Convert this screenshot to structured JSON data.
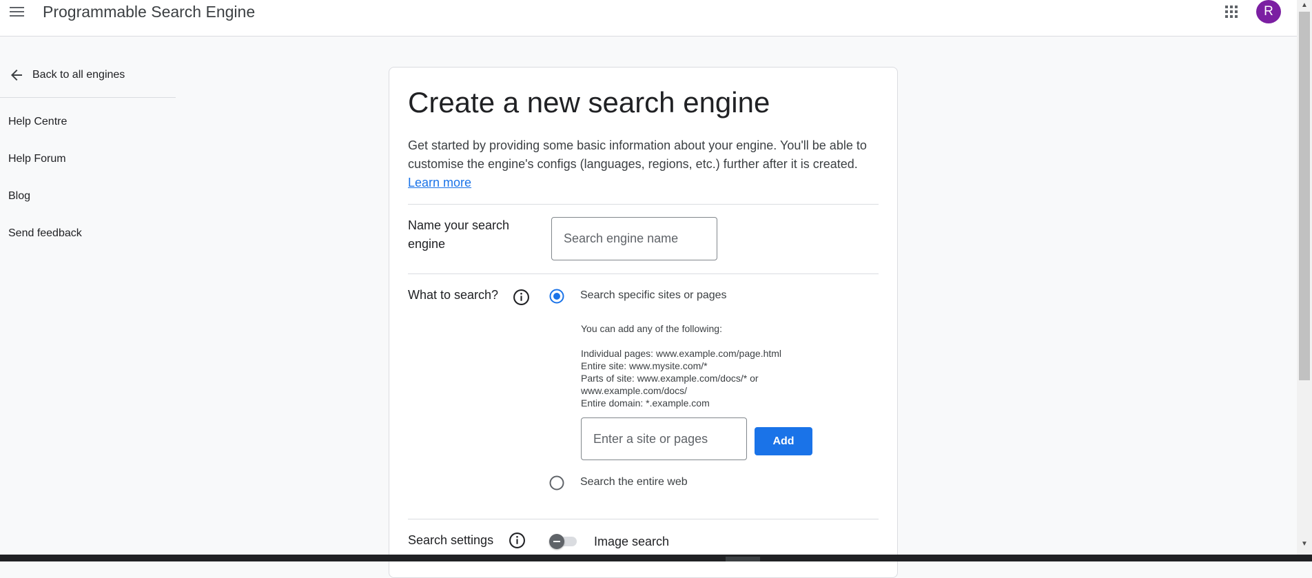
{
  "header": {
    "app_title": "Programmable Search Engine",
    "avatar_initial": "R",
    "avatar_color": "#7b1fa2"
  },
  "sidebar": {
    "back_label": "Back to all engines",
    "items": [
      {
        "label": "Help Centre"
      },
      {
        "label": "Help Forum"
      },
      {
        "label": "Blog"
      },
      {
        "label": "Send feedback"
      }
    ]
  },
  "form": {
    "title": "Create a new search engine",
    "description": "Get started by providing some basic information about your engine. You'll be able to customise the engine's configs (languages, regions, etc.) further after it is created.",
    "learn_more": "Learn more",
    "name_label": "Name your search engine",
    "name_placeholder": "Search engine name",
    "name_value": "",
    "what_label": "What to search?",
    "options": {
      "specific": "Search specific sites or pages",
      "entire": "Search the entire web"
    },
    "selected_option": "specific",
    "hint": {
      "intro": "You can add any of the following:",
      "lines": [
        "Individual pages: www.example.com/page.html",
        "Entire site: www.mysite.com/*",
        "Parts of site: www.example.com/docs/* or",
        "www.example.com/docs/",
        "Entire domain: *.example.com"
      ]
    },
    "site_placeholder": "Enter a site or pages",
    "site_value": "",
    "add_label": "Add",
    "settings_label": "Search settings",
    "image_search_label": "Image search",
    "image_search_enabled": false
  },
  "colors": {
    "accent": "#1a73e8",
    "page_bg": "#f8f9fa",
    "divider": "#dadce0"
  }
}
